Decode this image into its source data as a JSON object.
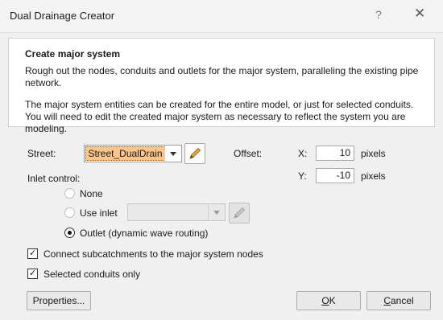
{
  "window": {
    "title": "Dual Drainage Creator",
    "help_glyph": "?",
    "close_glyph": "✕"
  },
  "panel": {
    "heading": "Create major system",
    "description_1": "Rough out the nodes, conduits and outlets for the major system, paralleling the existing pipe network.",
    "description_2": "The major system entities can be created for the entire model, or just for selected conduits. You will need to edit the created major system as necessary to reflect the system you are modeling."
  },
  "street": {
    "label": "Street:",
    "value": "Street_DualDrain",
    "highlight_color": "#f9c58a"
  },
  "offset": {
    "label": "Offset:",
    "x_label": "X:",
    "x_value": "10",
    "y_label": "Y:",
    "y_value": "-10",
    "unit": "pixels"
  },
  "inlet_control": {
    "label": "Inlet control:",
    "options": [
      "None",
      "Use inlet",
      "Outlet (dynamic wave routing)"
    ],
    "selected": "Outlet (dynamic wave routing)",
    "use_inlet_value": ""
  },
  "checkboxes": {
    "connect_label": "Connect subcatchments to the major system nodes",
    "connect_checked": true,
    "selected_label": "Selected conduits only",
    "selected_checked": true,
    "check_glyph": "✓"
  },
  "buttons": {
    "properties": "Properties...",
    "ok_mnemonic": "O",
    "ok_rest": "K",
    "cancel_mnemonic": "C",
    "cancel_rest": "ancel"
  },
  "icons": {
    "edit": "pencil-icon",
    "dropdown": "chevron-down-icon"
  }
}
